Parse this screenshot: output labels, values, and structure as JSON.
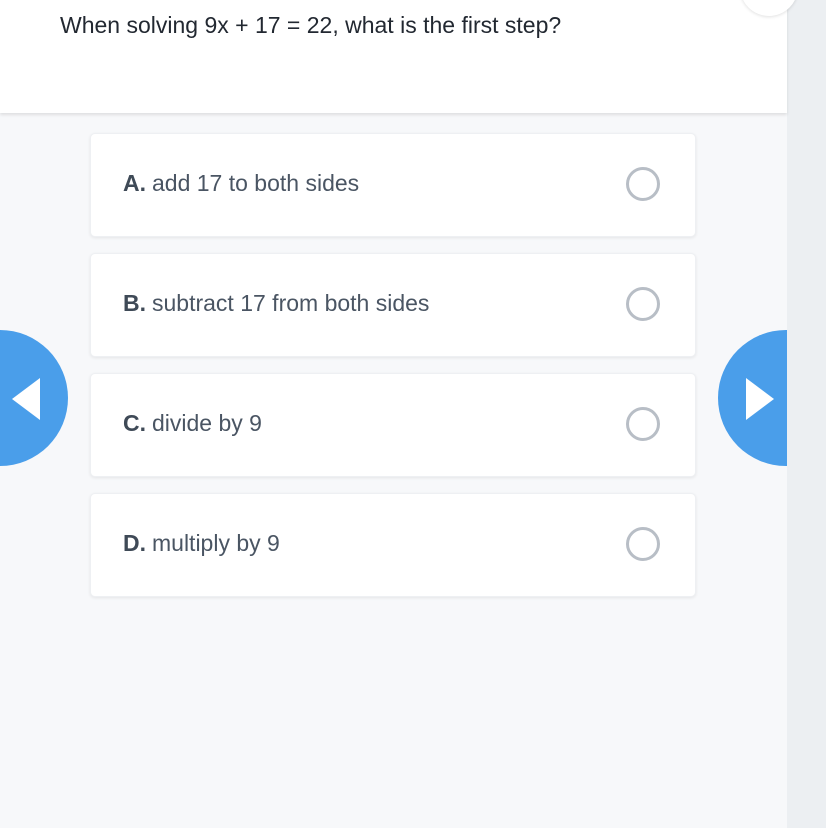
{
  "question": {
    "text": "When solving 9x + 17 = 22, what is the first step?"
  },
  "options": [
    {
      "letter": "A.",
      "text": "add 17 to both sides",
      "selected": false
    },
    {
      "letter": "B.",
      "text": "subtract 17 from both sides",
      "selected": false
    },
    {
      "letter": "C.",
      "text": "divide by 9",
      "selected": false
    },
    {
      "letter": "D.",
      "text": "multiply by 9",
      "selected": false
    }
  ],
  "navigation": {
    "prev_icon": "caret-left-icon",
    "next_icon": "caret-right-icon"
  },
  "colors": {
    "accent": "#4a9eea",
    "background": "#f7f8fa",
    "radio_border": "#b8bec6"
  }
}
